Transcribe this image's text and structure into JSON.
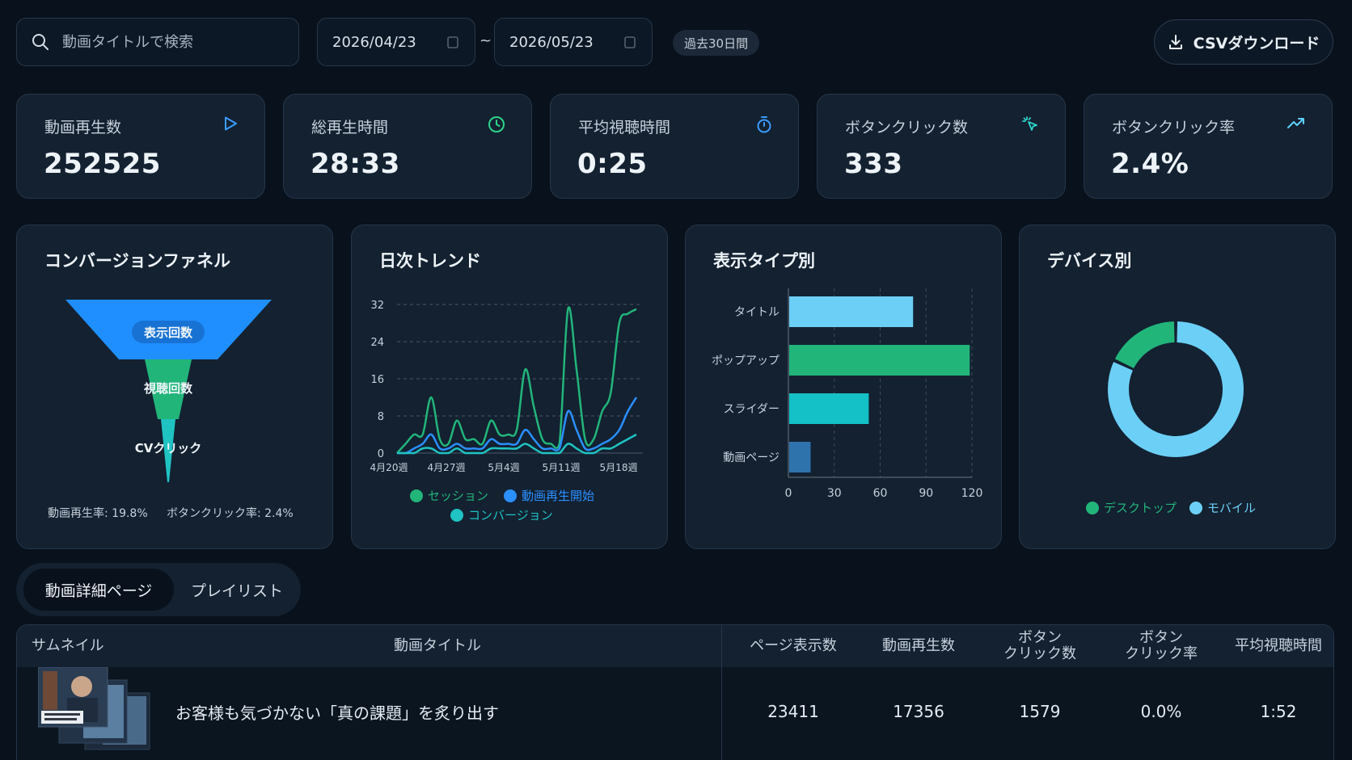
{
  "search": {
    "placeholder": "動画タイトルで検索"
  },
  "date_range": {
    "start": "2026/04/23",
    "separator": "~",
    "end": "2026/05/23",
    "preset": "過去30日間"
  },
  "csv_button": {
    "label": "CSVダウンロード"
  },
  "kpis": [
    {
      "label": "動画再生数",
      "value": "252525",
      "icon": "play-icon",
      "color": "#3b9cff"
    },
    {
      "label": "総再生時間",
      "value": "28:33",
      "icon": "clock-icon",
      "color": "#2fd38a"
    },
    {
      "label": "平均視聴時間",
      "value": "0:25",
      "icon": "timer-icon",
      "color": "#3b9cff"
    },
    {
      "label": "ボタンクリック数",
      "value": "333",
      "icon": "click-icon",
      "color": "#2fd3c7"
    },
    {
      "label": "ボタンクリック率",
      "value": "2.4%",
      "icon": "trending-up-icon",
      "color": "#5fd0ff"
    }
  ],
  "funnel": {
    "title": "コンバージョンファネル",
    "stages": [
      "表示回数",
      "視聴回数",
      "CVクリック"
    ],
    "footer_left": "動画再生率: 19.8%",
    "footer_right": "ボタンクリック率: 2.4%",
    "colors": [
      "#1f8fff",
      "#22b57a",
      "#1fc3c2"
    ]
  },
  "trend": {
    "title": "日次トレンド"
  },
  "display_type": {
    "title": "表示タイプ別"
  },
  "device": {
    "title": "デバイス別"
  },
  "chart_data": [
    {
      "type": "line",
      "x_ticks": [
        "4月20週",
        "4月27週",
        "5月4週",
        "5月11週",
        "5月18週"
      ],
      "ylim": [
        0,
        32
      ],
      "y_ticks": [
        0,
        8,
        16,
        24,
        32
      ],
      "grid": true,
      "legend_position": "bottom",
      "series": [
        {
          "name": "セッション",
          "color": "#22b57a",
          "values": [
            0,
            2,
            4,
            4,
            12,
            3,
            2,
            7,
            3,
            3,
            2,
            7,
            4,
            4,
            5,
            18,
            10,
            3,
            2,
            2,
            31,
            18,
            3,
            3,
            9,
            13,
            28,
            30,
            31
          ]
        },
        {
          "name": "動画再生開始",
          "color": "#2b8fff",
          "values": [
            0,
            0,
            1,
            2,
            4,
            1,
            1,
            2,
            1,
            1,
            1,
            3,
            2,
            2,
            2,
            5,
            3,
            1,
            1,
            1,
            9,
            5,
            1,
            1,
            2,
            3,
            5,
            9,
            12
          ]
        },
        {
          "name": "コンバージョン",
          "color": "#1fc3c2",
          "values": [
            0,
            0,
            0,
            1,
            1,
            0,
            0,
            1,
            0,
            0,
            0,
            1,
            1,
            1,
            1,
            2,
            1,
            0,
            0,
            0,
            2,
            1,
            0,
            0,
            1,
            1,
            2,
            3,
            4
          ]
        }
      ]
    },
    {
      "type": "bar",
      "orientation": "horizontal",
      "categories": [
        "タイトル",
        "ポップアップ",
        "スライダー",
        "動画ページ"
      ],
      "values": [
        81,
        118,
        52,
        14
      ],
      "colors": [
        "#6ccff6",
        "#22b57a",
        "#13c1c6",
        "#2f73ad"
      ],
      "xlim": [
        0,
        120
      ],
      "x_ticks": [
        0,
        30,
        60,
        90,
        120
      ],
      "grid": true
    },
    {
      "type": "pie",
      "donut": true,
      "categories": [
        "デスクトップ",
        "モバイル"
      ],
      "values": [
        18,
        82
      ],
      "colors": [
        "#22b57a",
        "#6ccff6"
      ],
      "legend_position": "bottom"
    }
  ],
  "tabs": [
    {
      "label": "動画詳細ページ",
      "active": true
    },
    {
      "label": "プレイリスト",
      "active": false
    }
  ],
  "table": {
    "headers": {
      "thumbnail": "サムネイル",
      "title": "動画タイトル",
      "page_views": "ページ表示数",
      "plays": "動画再生数",
      "clicks_1": "ボタン",
      "clicks_2": "クリック数",
      "rate_1": "ボタン",
      "rate_2": "クリック率",
      "avg_time": "平均視聴時間"
    },
    "rows": [
      {
        "title": "お客様も気づかない「真の課題」を炙り出す",
        "page_views": "23411",
        "plays": "17356",
        "clicks": "1579",
        "rate": "0.0%",
        "avg_time": "1:52"
      }
    ]
  }
}
